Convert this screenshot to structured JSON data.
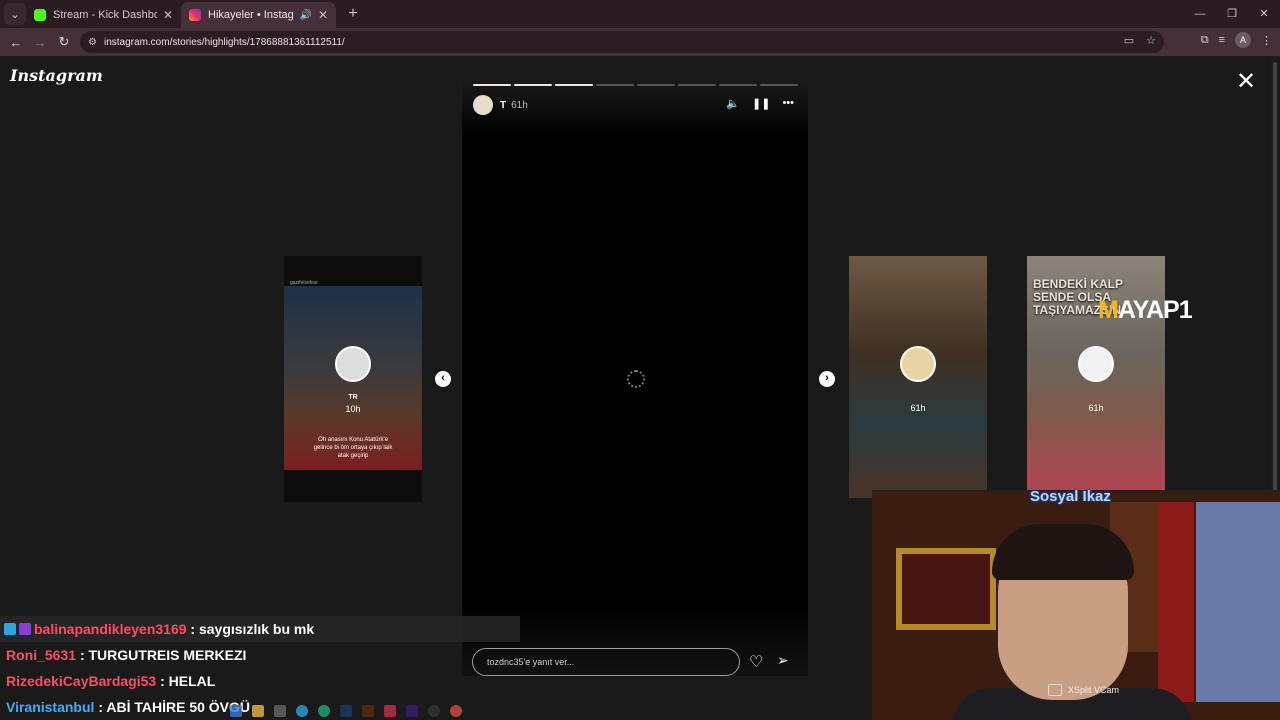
{
  "browser": {
    "tabs": [
      {
        "title": "Stream - Kick Dashboard",
        "favicon_color": "#53fc18",
        "active": false
      },
      {
        "title": "Hikayeler • Instagram",
        "favicon_color": "#e1306c",
        "active": true
      }
    ],
    "url": "instagram.com/stories/highlights/17868881361112511/",
    "profile_initial": "A"
  },
  "instagram": {
    "logo": "Instagram",
    "story": {
      "username": "T",
      "time": "61h",
      "progress_total": 8,
      "progress_done": 3,
      "reply_placeholder": "tozdnc35'e yanıt ver..."
    },
    "prev_card": {
      "header": "gazifelsefesi",
      "name": "TR",
      "time": "10h",
      "caption": "Oh anasını Konu Atatürk'e gelince bi öm ortaya çıkıp laik atak geçirip"
    },
    "next_cards": [
      {
        "time": "61h",
        "text": ""
      },
      {
        "time": "61h",
        "text": "BENDEKİ KALP SENDE OLSA TAŞIYAMAZSIN"
      }
    ],
    "sponsor": "MAYAP1"
  },
  "chat": [
    {
      "user": "balinapandikleyen3169",
      "message": ": saygısızlık bu mk",
      "badges": true
    },
    {
      "user": "Roni_5631",
      "message": ": TURGUTREIS MERKEZI",
      "badges": false
    },
    {
      "user": "RizedekiCayBardagi53",
      "message": ": HELAL",
      "badges": false
    },
    {
      "user": "Viranistanbul",
      "message": ": ABİ TAHİRE 50 ÖVGÜ",
      "badges": false
    }
  ],
  "webcam": {
    "title": "Sosyal Ikaz",
    "watermark": "XSplit VCam"
  }
}
